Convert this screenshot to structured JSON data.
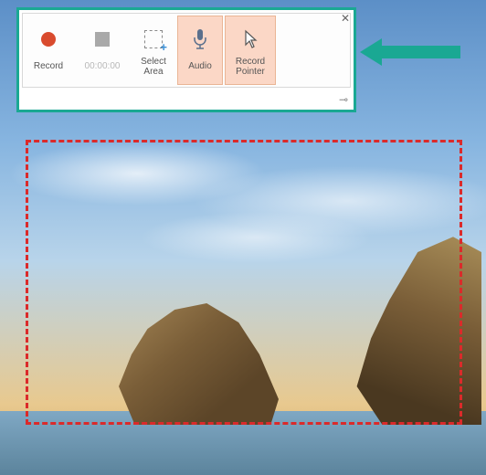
{
  "toolbar": {
    "record_label": "Record",
    "timer_value": "00:00:00",
    "select_area_label": "Select\nArea",
    "audio_label": "Audio",
    "record_pointer_label": "Record\nPointer"
  },
  "icons": {
    "record": "record-circle",
    "stop": "stop-square",
    "select_area": "dashed-square-plus",
    "audio": "microphone",
    "pointer": "cursor-arrow",
    "close": "close-x",
    "pin": "pin"
  },
  "colors": {
    "toolbar_border": "#1aa893",
    "active_button_bg": "#fbd7c6",
    "record_red": "#d94b2e",
    "selection_dash": "#db2a2a",
    "arrow": "#1aa893"
  }
}
